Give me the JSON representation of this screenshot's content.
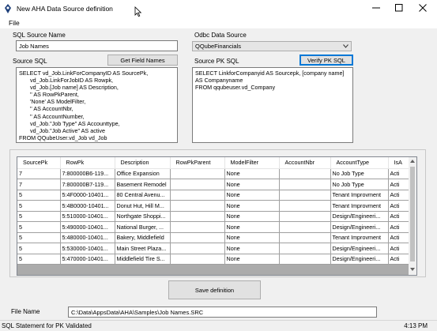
{
  "window": {
    "title": "New AHA Data Source definition",
    "app_icon": "app-icon",
    "minimize_icon": "minimize-icon",
    "maximize_icon": "maximize-icon",
    "close_icon": "close-icon"
  },
  "menu": {
    "file": "File"
  },
  "sql_source_name": {
    "label": "SQL Source Name",
    "value": "Job Names"
  },
  "odbc": {
    "label": "Odbc Data Source",
    "value": "QQubeFinancials"
  },
  "source_sql": {
    "label": "Source SQL",
    "button": "Get Field Names",
    "lines": [
      "SELECT vd_Job.LinkForCompanyID AS SourcePk,",
      "       vd_Job.LinkForJobID AS Rowpk,",
      "       vd_Job.[Job name] AS Description,",
      "       '' AS RowPkParent,",
      "       'None' AS ModelFilter,",
      "       '' AS AccountNbr,",
      "       '' AS AccountNumber,",
      "       vd_Job.\"Job Type\" AS Accounttype,",
      "       vd_Job.\"Job Active\" AS active",
      "FROM QQubeUser.vd_Job vd_Job"
    ]
  },
  "source_pk_sql": {
    "label": "Source PK SQL",
    "button": "Verify PK SQL",
    "lines": [
      "SELECT LinkforCompanyid AS Sourcepk, [company name]",
      "AS Companyname",
      "FROM qqubeuser.vd_Company"
    ]
  },
  "grid": {
    "columns": [
      "SourcePk",
      "RowPk",
      "Description",
      "RowPkParent",
      "ModelFilter",
      "AccountNbr",
      "AccountType",
      "IsA"
    ],
    "rows": [
      [
        "7",
        "7:800000B6-119...",
        "Office Expansion",
        "",
        "None",
        "",
        "No Job Type",
        "Acti"
      ],
      [
        "7",
        "7:800000B7-119...",
        "Basement Remodel",
        "",
        "None",
        "",
        "No Job Type",
        "Acti"
      ],
      [
        "5",
        "5:4F0000-10401...",
        "80 Central Avenu...",
        "",
        "None",
        "",
        "Tenant Improvment",
        "Acti"
      ],
      [
        "5",
        "5:4B0000-10401...",
        "Donut Hut, Hill M...",
        "",
        "None",
        "",
        "Tenant Improvment",
        "Acti"
      ],
      [
        "5",
        "5:510000-10401...",
        "Northgate Shoppi...",
        "",
        "None",
        "",
        "Design/Engineeri...",
        "Acti"
      ],
      [
        "5",
        "5:490000-10401...",
        "National Burger, ...",
        "",
        "None",
        "",
        "Design/Engineeri...",
        "Acti"
      ],
      [
        "5",
        "5:480000-10401...",
        "Bakery, Middlefield",
        "",
        "None",
        "",
        "Tenant Improvment",
        "Acti"
      ],
      [
        "5",
        "5:530000-10401...",
        "Main Street Plaza...",
        "",
        "None",
        "",
        "Design/Engineeri...",
        "Acti"
      ],
      [
        "5",
        "5:470000-10401...",
        "Middlefield Tire S...",
        "",
        "None",
        "",
        "Design/Engineeri...",
        "Acti"
      ]
    ]
  },
  "save_button": "Save definition",
  "file_name": {
    "label": "File Name",
    "value": "C:\\Data\\AppsData\\AHA\\Samples\\Job Names.SRC"
  },
  "status": {
    "message": "SQL Statement for PK Validated",
    "time": "4:13 PM"
  }
}
